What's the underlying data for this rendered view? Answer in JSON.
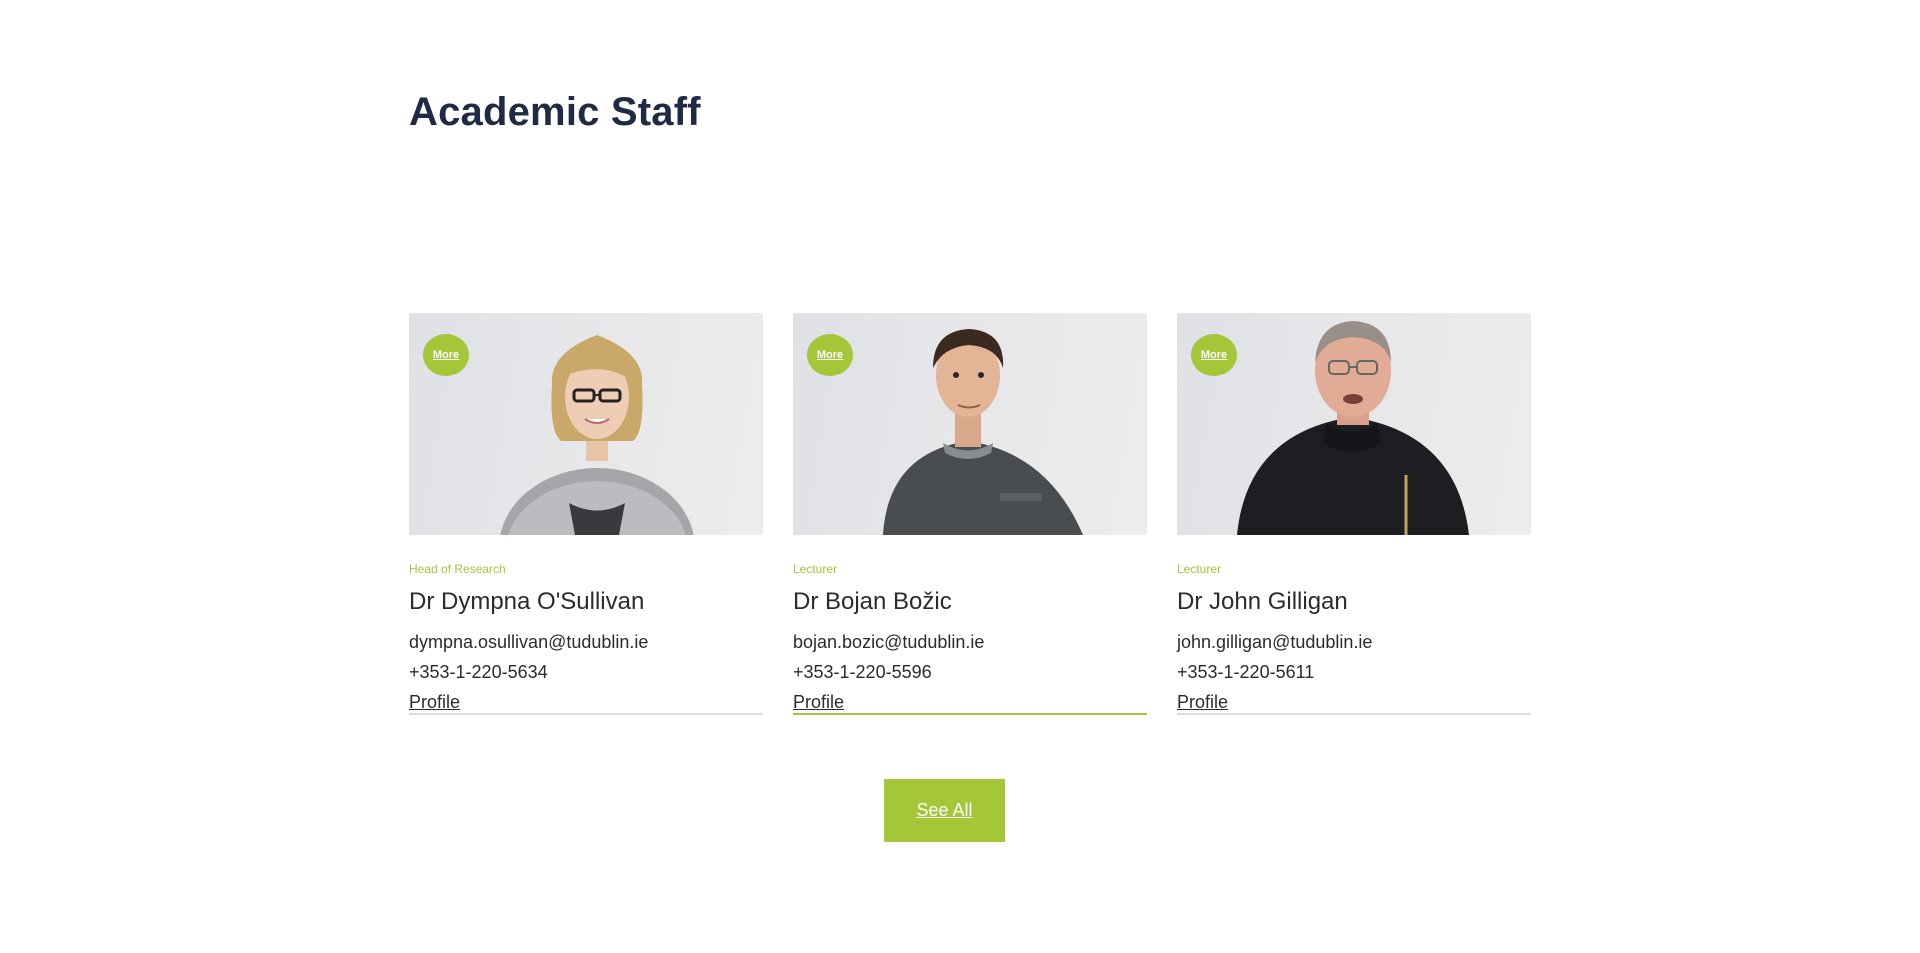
{
  "section": {
    "title": "Academic Staff"
  },
  "staff": [
    {
      "more_label": "More",
      "role": "Head of Research",
      "name": "Dr Dympna O'Sullivan",
      "email": "dympna.osullivan@tudublin.ie",
      "phone": "+353-1-220-5634",
      "profile_label": "Profile"
    },
    {
      "more_label": "More",
      "role": "Lecturer",
      "name": "Dr Bojan Božic",
      "email": "bojan.bozic@tudublin.ie",
      "phone": "+353-1-220-5596",
      "profile_label": "Profile"
    },
    {
      "more_label": "More",
      "role": "Lecturer",
      "name": "Dr John Gilligan",
      "email": "john.gilligan@tudublin.ie",
      "phone": "+353-1-220-5611",
      "profile_label": "Profile"
    }
  ],
  "see_all_label": "See All",
  "colors": {
    "accent": "#a4c639",
    "title": "#1f2a44",
    "text": "#2b2b2b"
  }
}
